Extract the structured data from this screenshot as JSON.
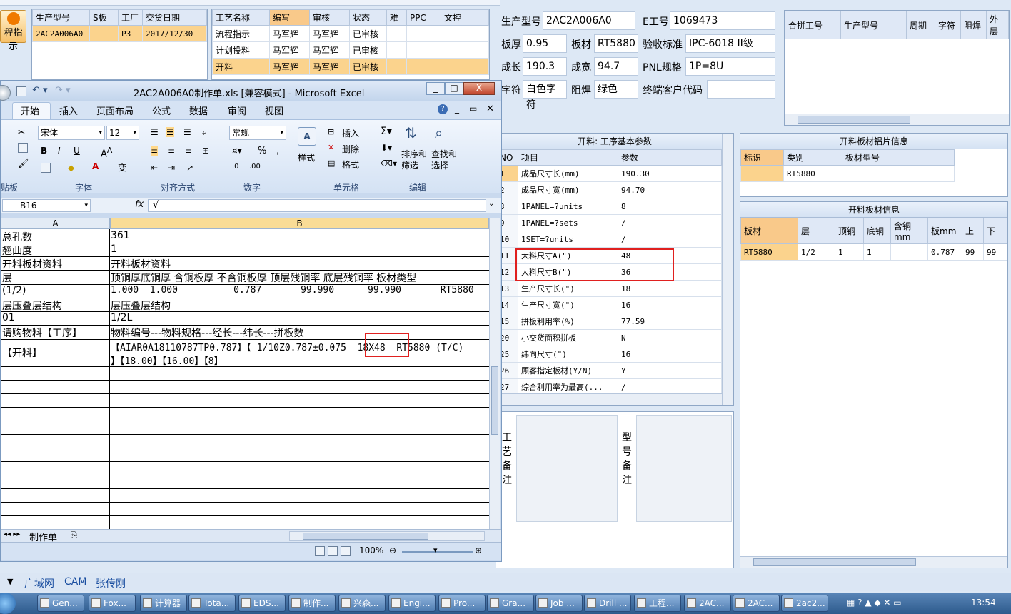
{
  "app": {
    "side_button": "程指示",
    "bottom_links": [
      "广域网",
      "CAM",
      "张传刚"
    ]
  },
  "left_grid": {
    "headers": [
      "生产型号",
      "S板",
      "工厂",
      "交货日期"
    ],
    "row": [
      "2AC2A006A0",
      "",
      "P3",
      "2017/12/30"
    ]
  },
  "process_grid": {
    "headers": [
      "工艺名称",
      "编写",
      "审核",
      "状态",
      "难",
      "PPC",
      "文控"
    ],
    "rows": [
      [
        "流程指示",
        "马军辉",
        "马军辉",
        "已审核"
      ],
      [
        "计划投料",
        "马军辉",
        "马军辉",
        "已审核"
      ],
      [
        "开料",
        "马军辉",
        "马军辉",
        "已审核"
      ]
    ]
  },
  "info": {
    "model_label": "生产型号",
    "model": "2AC2A006A0",
    "e_label": "E工号",
    "e_value": "1069473",
    "thickness_label": "板厚",
    "thickness": "0.95",
    "material_label": "板材",
    "material": "RT5880",
    "standard_label": "验收标准",
    "standard": "IPC-6018 II级",
    "len_label": "成长",
    "len": "190.3",
    "width_label": "成宽",
    "width": "94.7",
    "pnl_label": "PNL规格",
    "pnl": "1P=8U",
    "char_label": "字符",
    "char": "白色字符",
    "solder_label": "阻焊",
    "solder": "绿色",
    "customer_label": "终端客户代码"
  },
  "merge_grid": {
    "headers": [
      "合拼工号",
      "生产型号",
      "周期",
      "字符",
      "阻焊",
      "外层"
    ]
  },
  "params": {
    "caption": "开料: 工序基本参数",
    "headers": [
      "NO",
      "项目",
      "参数"
    ],
    "rows": [
      [
        "1",
        "成品尺寸长(mm)",
        "190.30"
      ],
      [
        "2",
        "成品尺寸宽(mm)",
        "94.70"
      ],
      [
        "3",
        "1PANEL=?units",
        "8"
      ],
      [
        "9",
        "1PANEL=?sets",
        "/"
      ],
      [
        "10",
        "1SET=?units",
        "/"
      ],
      [
        "11",
        "大料尺寸A(\")",
        "48"
      ],
      [
        "12",
        "大料尺寸B(\")",
        "36"
      ],
      [
        "13",
        "生产尺寸长(\")",
        "18"
      ],
      [
        "14",
        "生产尺寸宽(\")",
        "16"
      ],
      [
        "15",
        "拼板利用率(%)",
        "77.59"
      ],
      [
        "20",
        "小交货面积拼板",
        "N"
      ],
      [
        "25",
        "纬向尺寸(\")",
        "16"
      ],
      [
        "26",
        "顾客指定板材(Y/N)",
        "Y"
      ],
      [
        "27",
        "综合利用率为最高(...",
        "/"
      ]
    ]
  },
  "notes": {
    "left": "工艺备注",
    "right": "型号备注"
  },
  "foil_info": {
    "caption": "开料板材铝片信息",
    "headers": [
      "标识",
      "类别",
      "板材型号"
    ],
    "row": [
      "",
      "RT5880",
      ""
    ]
  },
  "board_info": {
    "caption": "开料板材信息",
    "headers": [
      "板材",
      "层",
      "顶铜",
      "底铜",
      "含铜mm",
      "板mm",
      "上",
      "下"
    ],
    "row": [
      "RT5880",
      "1/2",
      "1",
      "1",
      "",
      "0.787",
      "99",
      "99"
    ]
  },
  "excel": {
    "title": "2AC2A006A0制作单.xls [兼容模式] - Microsoft Excel",
    "tabs": [
      "开始",
      "插入",
      "页面布局",
      "公式",
      "数据",
      "审阅",
      "视图"
    ],
    "font_name": "宋体",
    "font_size": "12",
    "number_format": "常规",
    "group_labels": [
      "贴板",
      "字体",
      "对齐方式",
      "数字",
      "单元格",
      "编辑"
    ],
    "buttons": {
      "style": "样式",
      "insert": "插入",
      "delete": "删除",
      "format": "格式",
      "sort": "排序和\n筛选",
      "find": "查找和\n选择"
    },
    "name_box": "B16",
    "formula": "√",
    "col_a": "A",
    "col_b": "B",
    "rows": [
      [
        "总孔数",
        "361"
      ],
      [
        "翘曲度",
        "1"
      ],
      [
        "开料板材资料",
        "开料板材资料"
      ],
      [
        "层",
        "顶铜厚底铜厚 含铜板厚 不含铜板厚 顶层残铜率 底层残铜率 板材类型"
      ],
      [
        "(1/2)",
        "1.000  1.000          0.787       99.990      99.990       RT5880"
      ],
      [
        "层压叠层结构",
        "层压叠层结构"
      ],
      [
        "01",
        "1/2L"
      ],
      [
        "请购物料【工序】",
        "物料编号---物料规格---经长---纬长---拼板数"
      ],
      [
        "【开料】",
        "【AIAR0A18110787TP0.787】【 1/10Z0.787±0.075  18X48  RT5880 (T/C)\n】【18.00】【16.00】【8】"
      ]
    ],
    "sheet_tab": "制作单",
    "zoom": "100%"
  },
  "taskbar": {
    "buttons": [
      "Gen...",
      "Fox...",
      "计算器",
      "Tota...",
      "EDS...",
      "制作...",
      "兴森...",
      "Engi...",
      "Pro...",
      "Gra...",
      "Job ...",
      "Drill ...",
      "工程...",
      "2AC...",
      "2AC...",
      "2ac2..."
    ],
    "time": "13:54"
  }
}
